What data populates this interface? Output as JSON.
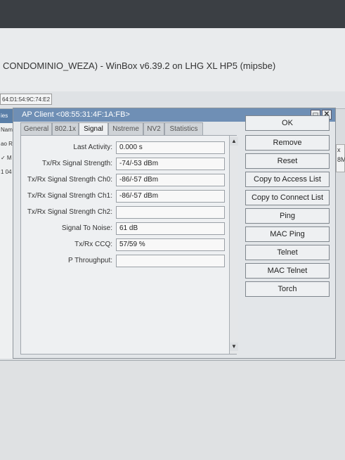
{
  "window": {
    "title": "CONDOMINIO_WEZA) - WinBox v6.39.2 on LHG XL HP5 (mipsbe)",
    "mac_field": "64:D1:54:9C:74:E2"
  },
  "left_panel": [
    "ies",
    "Name",
    "ao Re",
    "✓ M",
    "1  04"
  ],
  "right_stub": "x\n8M",
  "dialog": {
    "title": "AP Client <08:55:31:4F:1A:FB>",
    "tabs": [
      "General",
      "802.1x",
      "Signal",
      "Nstreme",
      "NV2",
      "Statistics"
    ],
    "active_tab": "Signal",
    "rows": [
      {
        "label": "Last Activity:",
        "value": "0.000 s"
      },
      {
        "label": "Tx/Rx Signal Strength:",
        "value": "-74/-53 dBm"
      },
      {
        "label": "Tx/Rx Signal Strength Ch0:",
        "value": "-86/-57 dBm"
      },
      {
        "label": "Tx/Rx Signal Strength Ch1:",
        "value": "-86/-57 dBm"
      },
      {
        "label": "Tx/Rx Signal Strength Ch2:",
        "value": ""
      },
      {
        "label": "Signal To Noise:",
        "value": "61 dB"
      },
      {
        "label": "Tx/Rx CCQ:",
        "value": "57/59 %"
      },
      {
        "label": "P Throughput:",
        "value": ""
      }
    ],
    "buttons": [
      "OK",
      "Remove",
      "Reset",
      "Copy to Access List",
      "Copy to Connect List",
      "Ping",
      "MAC Ping",
      "Telnet",
      "MAC Telnet",
      "Torch"
    ]
  },
  "icons": {
    "restore": "restore-icon",
    "close": "close-icon",
    "scroll_up": "arrow-up-icon",
    "scroll_down": "arrow-down-icon"
  }
}
